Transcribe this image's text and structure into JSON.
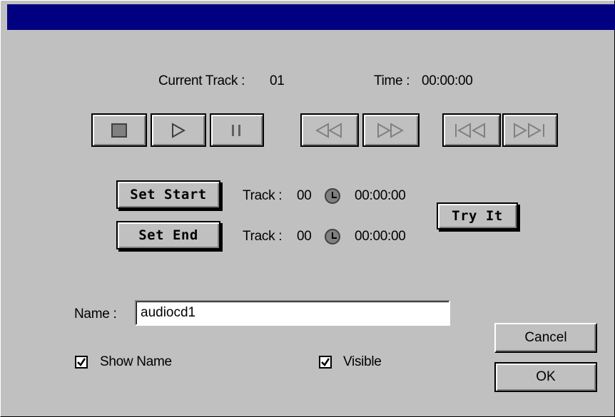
{
  "status": {
    "current_track_label": "Current Track :",
    "current_track_value": "01",
    "time_label": "Time :",
    "time_value": "00:00:00"
  },
  "transport": {
    "buttons": [
      {
        "name": "stop",
        "icon": "stop-icon"
      },
      {
        "name": "play",
        "icon": "play-icon"
      },
      {
        "name": "pause",
        "icon": "pause-icon"
      },
      {
        "name": "rewind",
        "icon": "rewind-icon"
      },
      {
        "name": "fast-forward",
        "icon": "fast-forward-icon"
      },
      {
        "name": "previous-track",
        "icon": "skip-back-icon"
      },
      {
        "name": "next-track",
        "icon": "skip-forward-icon"
      }
    ]
  },
  "range": {
    "set_start_label": "Set Start",
    "set_end_label": "Set End",
    "start_track_label": "Track :",
    "start_track_value": "00",
    "start_time": "00:00:00",
    "end_track_label": "Track :",
    "end_track_value": "00",
    "end_time": "00:00:00",
    "try_it_label": "Try It"
  },
  "form": {
    "name_label": "Name :",
    "name_value": "audiocd1",
    "show_name_label": "Show Name",
    "show_name_checked": true,
    "visible_label": "Visible",
    "visible_checked": true
  },
  "actions": {
    "cancel_label": "Cancel",
    "ok_label": "OK"
  },
  "colors": {
    "titlebar": "#000080",
    "face": "#c0c0c0"
  }
}
